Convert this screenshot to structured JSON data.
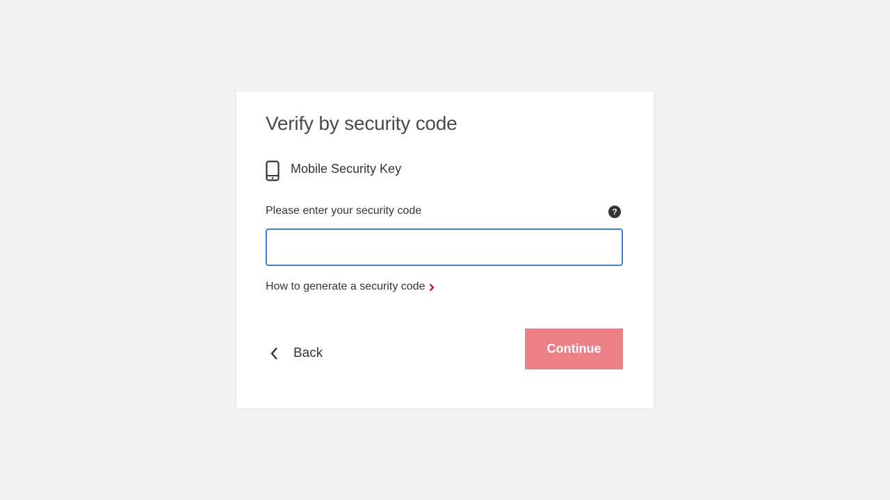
{
  "page": {
    "background_color": "#f2f2f2"
  },
  "card": {
    "title": "Verify by security code",
    "method": {
      "icon": "mobile-phone-icon",
      "label": "Mobile Security Key"
    },
    "field": {
      "label": "Please enter your security code",
      "help_icon": "question-circle-icon",
      "help_glyph": "?",
      "value": "",
      "placeholder": ""
    },
    "help_link": {
      "label": "How to generate a security code",
      "icon": "chevron-right-icon"
    },
    "back": {
      "icon": "chevron-left-icon",
      "label": "Back"
    },
    "continue": {
      "label": "Continue"
    }
  },
  "colors": {
    "accent_input_border": "#3f7fd6",
    "continue_button": "#ed7f88",
    "link_chevron": "#db0011",
    "text": "#333333"
  }
}
